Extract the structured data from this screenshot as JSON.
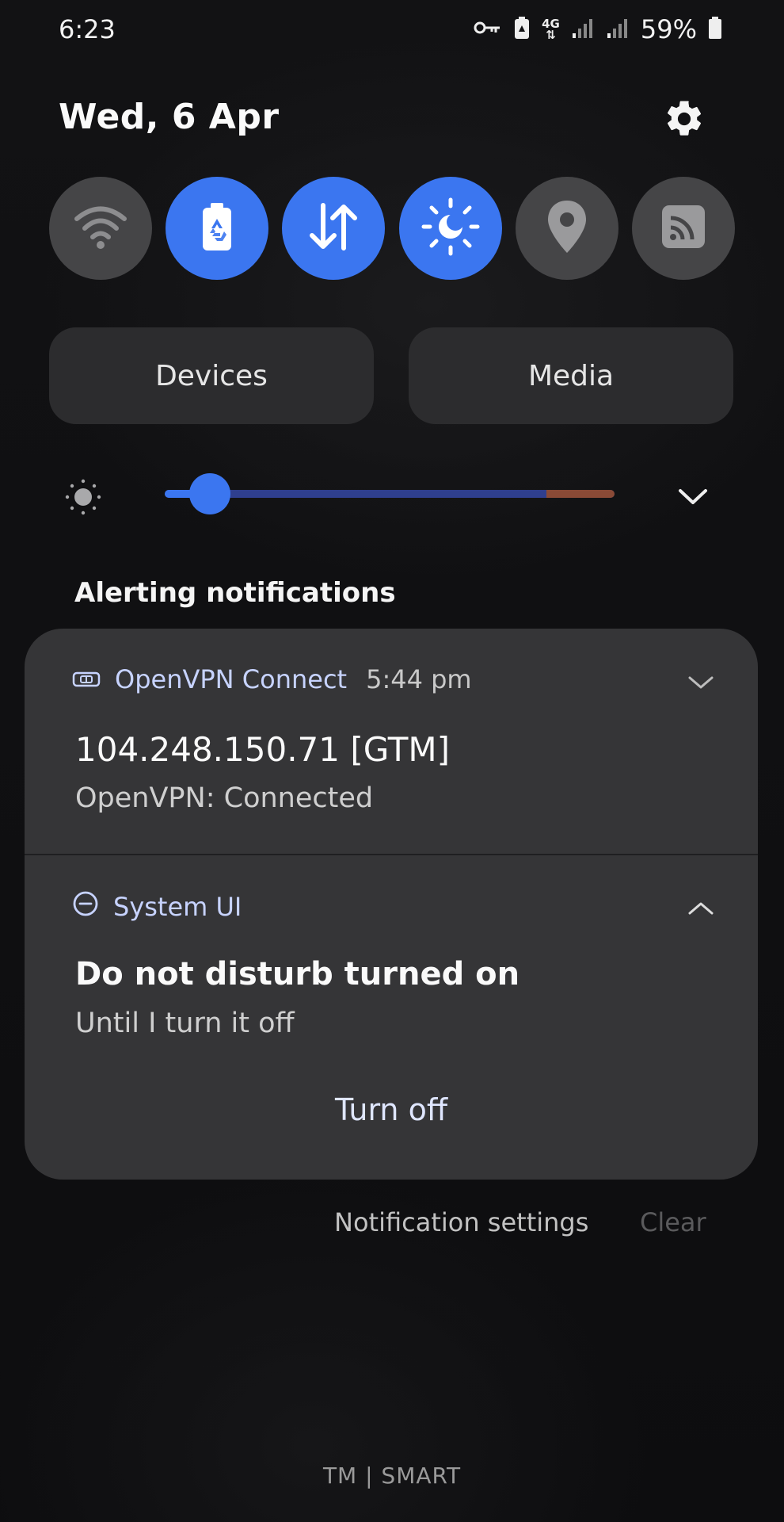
{
  "status_bar": {
    "time": "6:23",
    "network_type": "4G",
    "battery_percent": "59%"
  },
  "header": {
    "date": "Wed, 6 Apr"
  },
  "quick_toggles": [
    {
      "icon": "wifi-icon",
      "active": false
    },
    {
      "icon": "power-saving-icon",
      "active": true
    },
    {
      "icon": "mobile-data-icon",
      "active": true
    },
    {
      "icon": "eye-comfort-icon",
      "active": true
    },
    {
      "icon": "location-icon",
      "active": false
    },
    {
      "icon": "cast-icon",
      "active": false
    }
  ],
  "buttons": {
    "devices": "Devices",
    "media": "Media"
  },
  "brightness": {
    "level": 0.1
  },
  "section": {
    "title": "Alerting notifications"
  },
  "notifications": [
    {
      "app": "OpenVPN Connect",
      "time": "5:44 pm",
      "title": "104.248.150.71 [GTM]",
      "body": "OpenVPN: Connected"
    },
    {
      "app": "System UI",
      "title": "Do not disturb turned on",
      "body": "Until I turn it off",
      "action": "Turn off"
    }
  ],
  "footer": {
    "notification_settings": "Notification settings",
    "clear": "Clear",
    "carrier": "TM | SMART"
  },
  "colors": {
    "accent": "#3b76f0",
    "card": "#353537",
    "tile_off": "#454547"
  }
}
